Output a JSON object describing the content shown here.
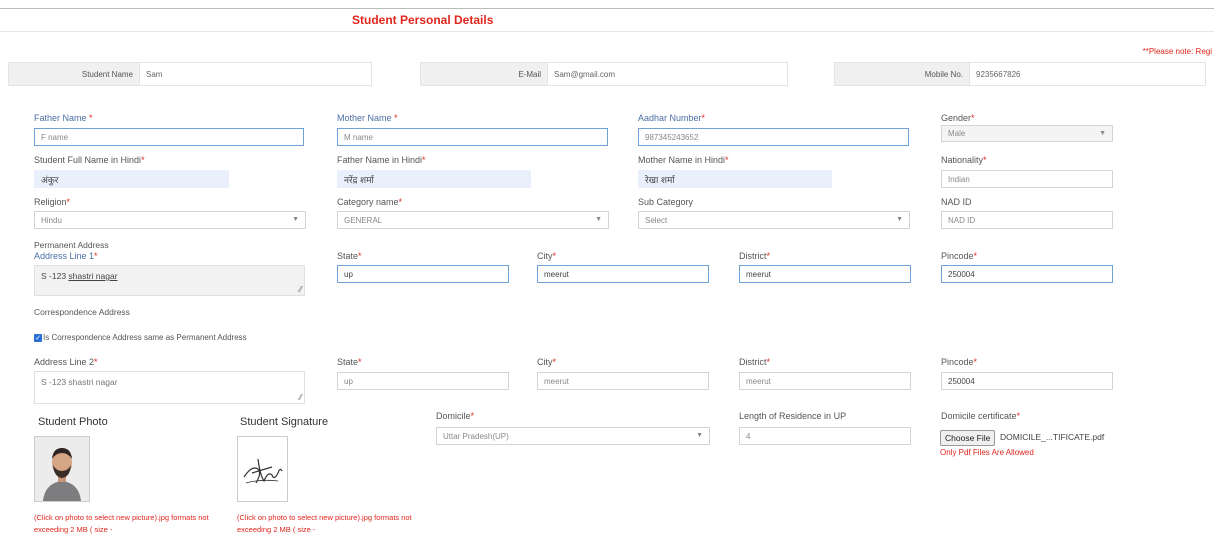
{
  "header": {
    "title": "Student Personal Details",
    "note": "**Please note: Regi"
  },
  "student_info": {
    "name_label": "Student Name",
    "name_value": "Sam",
    "email_label": "E-Mail",
    "email_value": "Sam@gmail.com",
    "mobile_label": "Mobile No.",
    "mobile_value": "9235667826"
  },
  "labels": {
    "father_name": "Father Name ",
    "mother_name": "Mother Name ",
    "aadhar": "Aadhar Number",
    "gender": "Gender",
    "student_hindi": "Student Full Name in Hindi",
    "father_hindi": "Father Name in Hindi",
    "mother_hindi": "Mother Name in Hindi",
    "nationality": "Nationality",
    "religion": "Religion",
    "category": "Category name",
    "sub_category": "Sub Category",
    "nad_id": "NAD ID",
    "permanent_address": "Permanent Address",
    "address_line1": "Address Line 1",
    "state": "State",
    "city": "City",
    "district": "District",
    "pincode": "Pincode",
    "correspondence_address": "Correspondence Address",
    "same_as_permanent": "Is Correspondence Address same as Permanent Address",
    "address_line2": "Address Line 2",
    "student_photo": "Student Photo",
    "student_signature": "Student Signature",
    "domicile": "Domicile",
    "residence_length": "Length of Residence in UP",
    "domicile_certificate": "Domicile certificate"
  },
  "required_mark": "*",
  "values": {
    "father_name_placeholder": "F name",
    "mother_name_placeholder": "M name",
    "aadhar": "987345243652",
    "gender": "Male",
    "student_hindi": "अंकुर",
    "father_hindi": "नरेंद्र शर्मा",
    "mother_hindi": "रेखा शर्मा",
    "nationality": "Indian",
    "religion": "Hindu",
    "category": "GENERAL",
    "sub_category": "Select",
    "nad_id_placeholder": "NAD ID",
    "perm_address_prefix": "S -123 ",
    "perm_address_link": "shastri nagar",
    "perm_state": "up",
    "perm_city": "meerut",
    "perm_district": "meerut",
    "perm_pincode": "250004",
    "corr_address": "S -123 shastri nagar",
    "corr_state": "up",
    "corr_city": "meerut",
    "corr_district": "meerut",
    "corr_pincode": "250004",
    "domicile": "Uttar Pradesh(UP)",
    "residence_length": "4"
  },
  "photo_hint": "(Click on photo to select new picture).jpg formats not exceeding 2 MB ( size -",
  "signature_hint": "(Click on photo to select new picture).jpg formats not exceeding 2 MB ( size -",
  "file": {
    "button": "Choose File",
    "name": "DOMICILE_...TIFICATE.pdf",
    "note": "Only Pdf Files Are Allowed"
  },
  "icons": {
    "caret": "chevron-down-icon",
    "checkbox": "check-icon",
    "resize": "resize-grip-icon"
  },
  "colors": {
    "accent_red": "#e0261d",
    "focus_blue": "#6fa3d8",
    "hindi_bg": "#e9effb",
    "checkbox_blue": "#2a6fd6"
  }
}
